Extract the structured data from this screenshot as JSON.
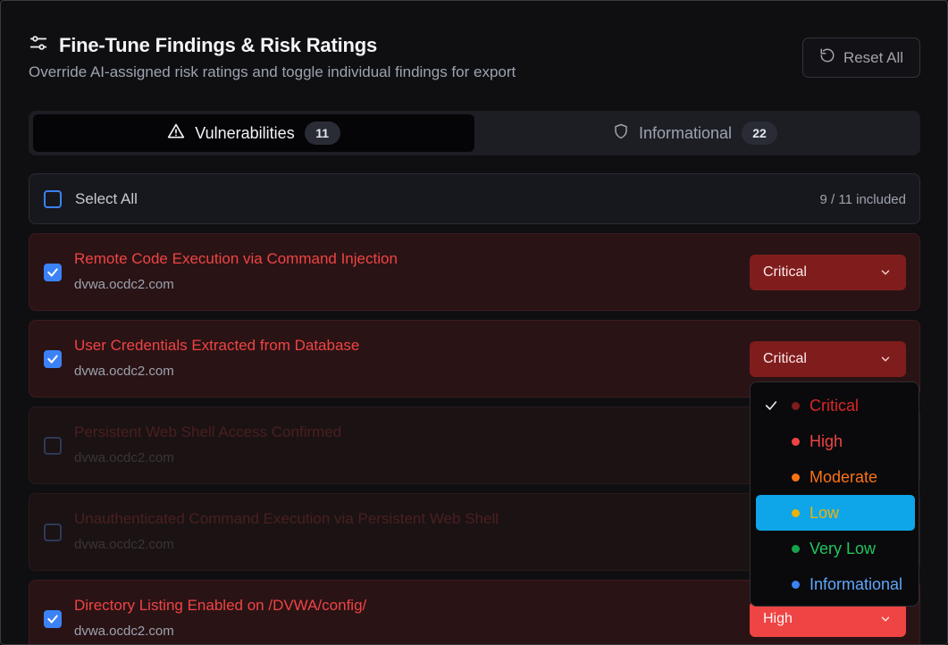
{
  "header": {
    "title": "Fine-Tune Findings & Risk Ratings",
    "subtitle": "Override AI-assigned risk ratings and toggle individual findings for export",
    "reset_label": "Reset All"
  },
  "tabs": [
    {
      "label": "Vulnerabilities",
      "count": "11",
      "active": true
    },
    {
      "label": "Informational",
      "count": "22",
      "active": false
    }
  ],
  "select_all": {
    "label": "Select All",
    "included": "9 / 11 included"
  },
  "findings": [
    {
      "title": "Remote Code Execution via Command Injection",
      "host": "dvwa.ocdc2.com",
      "checked": true,
      "rating": "Critical"
    },
    {
      "title": "User Credentials Extracted from Database",
      "host": "dvwa.ocdc2.com",
      "checked": true,
      "rating": "Critical"
    },
    {
      "title": "Persistent Web Shell Access Confirmed",
      "host": "dvwa.ocdc2.com",
      "checked": false,
      "rating": ""
    },
    {
      "title": "Unauthenticated Command Execution via Persistent Web Shell",
      "host": "dvwa.ocdc2.com",
      "checked": false,
      "rating": ""
    },
    {
      "title": "Directory Listing Enabled on /DVWA/config/",
      "host": "dvwa.ocdc2.com",
      "checked": true,
      "rating": "High"
    }
  ],
  "rating_menu": {
    "options": [
      {
        "label": "Critical",
        "color": "#dc2626",
        "dot": "#7f1d1d",
        "selected": true
      },
      {
        "label": "High",
        "color": "#ef4444",
        "dot": "#ef4444",
        "selected": false
      },
      {
        "label": "Moderate",
        "color": "#f97316",
        "dot": "#f97316",
        "selected": false
      },
      {
        "label": "Low",
        "color": "#eab308",
        "dot": "#eab308",
        "highlighted": true
      },
      {
        "label": "Very Low",
        "color": "#22c55e",
        "dot": "#16a34a",
        "selected": false
      },
      {
        "label": "Informational",
        "color": "#60a5fa",
        "dot": "#3b82f6",
        "selected": false
      }
    ]
  },
  "colors": {
    "accent": "#3b82f6",
    "critical_bg": "#7f1d1d",
    "high_bg": "#ef4444",
    "highlight": "#0ea5e9"
  },
  "icons": {
    "title": "sliders-icon",
    "reset": "rotate-ccw-icon",
    "vuln_tab": "warning-triangle-icon",
    "info_tab": "shield-icon",
    "select": "chevron-down-icon",
    "selected": "check-icon"
  }
}
